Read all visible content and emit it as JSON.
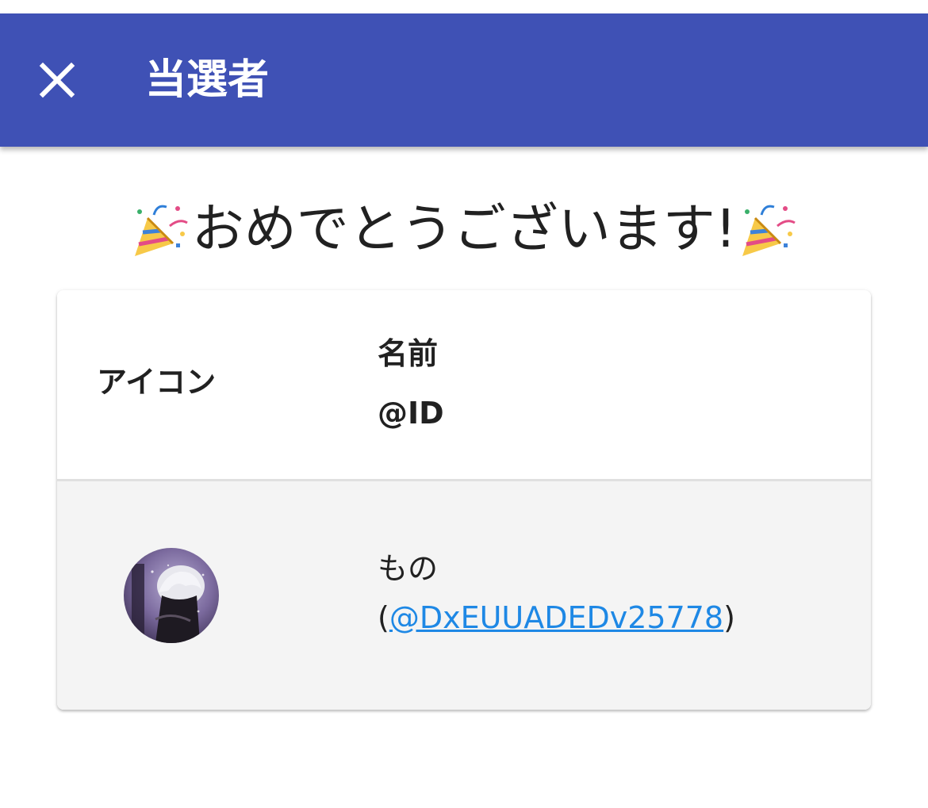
{
  "app_bar": {
    "title": "当選者",
    "close_icon": "close-icon",
    "background_color": "#3f51b5"
  },
  "congrats": {
    "text": "おめでとうございます!",
    "icon": "party-popper-icon"
  },
  "table": {
    "headers": {
      "icon": "アイコン",
      "name": "名前",
      "id": "@ID"
    },
    "rows": [
      {
        "avatar": "avatar-image",
        "name": "もの",
        "paren_open": "(",
        "handle": "@DxEUUADEDv25778",
        "paren_close": ")"
      }
    ]
  },
  "colors": {
    "link": "#1e88e5",
    "row_background": "#f4f4f4"
  }
}
